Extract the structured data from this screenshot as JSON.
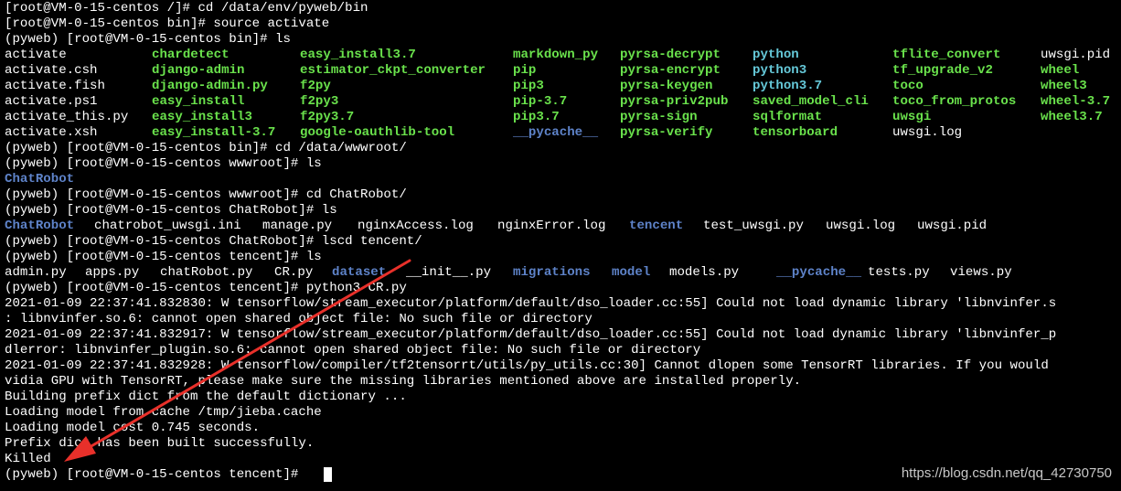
{
  "terminal": {
    "prompt_root_1": "[root@VM-0-15-centos /]# cd /data/env/pyweb/bin",
    "prompt_root_2": "[root@VM-0-15-centos bin]# source activate",
    "prompt_ls_bin": "(pyweb) [root@VM-0-15-centos bin]# ls",
    "bin_listing": [
      [
        {
          "text": "activate",
          "color": "white"
        },
        {
          "text": "chardetect",
          "color": "green"
        },
        {
          "text": "easy_install3.7",
          "color": "green"
        },
        {
          "text": "markdown_py",
          "color": "green"
        },
        {
          "text": "pyrsa-decrypt",
          "color": "green"
        },
        {
          "text": "python",
          "color": "cyan"
        },
        {
          "text": "tflite_convert",
          "color": "green"
        },
        {
          "text": "uwsgi.pid",
          "color": "white"
        }
      ],
      [
        {
          "text": "activate.csh",
          "color": "white"
        },
        {
          "text": "django-admin",
          "color": "green"
        },
        {
          "text": "estimator_ckpt_converter",
          "color": "green"
        },
        {
          "text": "pip",
          "color": "green"
        },
        {
          "text": "pyrsa-encrypt",
          "color": "green"
        },
        {
          "text": "python3",
          "color": "cyan"
        },
        {
          "text": "tf_upgrade_v2",
          "color": "green"
        },
        {
          "text": "wheel",
          "color": "green"
        }
      ],
      [
        {
          "text": "activate.fish",
          "color": "white"
        },
        {
          "text": "django-admin.py",
          "color": "green"
        },
        {
          "text": "f2py",
          "color": "green"
        },
        {
          "text": "pip3",
          "color": "green"
        },
        {
          "text": "pyrsa-keygen",
          "color": "green"
        },
        {
          "text": "python3.7",
          "color": "cyan"
        },
        {
          "text": "toco",
          "color": "green"
        },
        {
          "text": "wheel3",
          "color": "green"
        }
      ],
      [
        {
          "text": "activate.ps1",
          "color": "white"
        },
        {
          "text": "easy_install",
          "color": "green"
        },
        {
          "text": "f2py3",
          "color": "green"
        },
        {
          "text": "pip-3.7",
          "color": "green"
        },
        {
          "text": "pyrsa-priv2pub",
          "color": "green"
        },
        {
          "text": "saved_model_cli",
          "color": "green"
        },
        {
          "text": "toco_from_protos",
          "color": "green"
        },
        {
          "text": "wheel-3.7",
          "color": "green"
        }
      ],
      [
        {
          "text": "activate_this.py",
          "color": "white"
        },
        {
          "text": "easy_install3",
          "color": "green"
        },
        {
          "text": "f2py3.7",
          "color": "green"
        },
        {
          "text": "pip3.7",
          "color": "green"
        },
        {
          "text": "pyrsa-sign",
          "color": "green"
        },
        {
          "text": "sqlformat",
          "color": "green"
        },
        {
          "text": "uwsgi",
          "color": "green"
        },
        {
          "text": "wheel3.7",
          "color": "green"
        }
      ],
      [
        {
          "text": "activate.xsh",
          "color": "white"
        },
        {
          "text": "easy_install-3.7",
          "color": "green"
        },
        {
          "text": "google-oauthlib-tool",
          "color": "green"
        },
        {
          "text": "__pycache__",
          "color": "blue"
        },
        {
          "text": "pyrsa-verify",
          "color": "green"
        },
        {
          "text": "tensorboard",
          "color": "green"
        },
        {
          "text": "uwsgi.log",
          "color": "white"
        },
        {
          "text": "",
          "color": "white"
        }
      ]
    ],
    "prompt_cd_wwwroot": "(pyweb) [root@VM-0-15-centos bin]# cd /data/wwwroot/",
    "prompt_ls_wwwroot": "(pyweb) [root@VM-0-15-centos wwwroot]# ls",
    "wwwroot_listing": "ChatRobot",
    "prompt_cd_chatrobot": "(pyweb) [root@VM-0-15-centos wwwroot]# cd ChatRobot/",
    "prompt_ls_chatrobot": "(pyweb) [root@VM-0-15-centos ChatRobot]# ls",
    "chatrobot_listing": [
      {
        "text": "ChatRobot",
        "color": "blue"
      },
      {
        "text": "chatrobot_uwsgi.ini",
        "color": "white"
      },
      {
        "text": "manage.py",
        "color": "white"
      },
      {
        "text": "nginxAccess.log",
        "color": "white"
      },
      {
        "text": "nginxError.log",
        "color": "white"
      },
      {
        "text": "tencent",
        "color": "blue"
      },
      {
        "text": "test_uwsgi.py",
        "color": "white"
      },
      {
        "text": "uwsgi.log",
        "color": "white"
      },
      {
        "text": "uwsgi.pid",
        "color": "white"
      }
    ],
    "prompt_ls_chatrobot_2": "(pyweb) [root@VM-0-15-centos ChatRobot]# ls",
    "cd_tencent_cmd": "cd tencent/",
    "prompt_ls_tencent": "(pyweb) [root@VM-0-15-centos tencent]# ls",
    "tencent_listing": [
      {
        "text": "admin.py",
        "color": "white"
      },
      {
        "text": "apps.py",
        "color": "white"
      },
      {
        "text": "chatRobot.py",
        "color": "white"
      },
      {
        "text": "CR.py",
        "color": "white"
      },
      {
        "text": "dataset",
        "color": "blue"
      },
      {
        "text": "__init__.py",
        "color": "white"
      },
      {
        "text": "migrations",
        "color": "blue"
      },
      {
        "text": "model",
        "color": "blue"
      },
      {
        "text": "models.py",
        "color": "white"
      },
      {
        "text": "__pycache__",
        "color": "blue"
      },
      {
        "text": "tests.py",
        "color": "white"
      },
      {
        "text": "views.py",
        "color": "white"
      }
    ],
    "prompt_run": "(pyweb) [root@VM-0-15-centos tencent]# python3 CR.py",
    "log_lines": [
      "2021-01-09 22:37:41.832830: W tensorflow/stream_executor/platform/default/dso_loader.cc:55] Could not load dynamic library 'libnvinfer.s",
      ": libnvinfer.so.6: cannot open shared object file: No such file or directory",
      "2021-01-09 22:37:41.832917: W tensorflow/stream_executor/platform/default/dso_loader.cc:55] Could not load dynamic library 'libnvinfer_p",
      "dlerror: libnvinfer_plugin.so.6: cannot open shared object file: No such file or directory",
      "2021-01-09 22:37:41.832928: W tensorflow/compiler/tf2tensorrt/utils/py_utils.cc:30] Cannot dlopen some TensorRT libraries. If you would",
      "vidia GPU with TensorRT, please make sure the missing libraries mentioned above are installed properly.",
      "Building prefix dict from the default dictionary ...",
      "Loading model from cache /tmp/jieba.cache",
      "Loading model cost 0.745 seconds.",
      "Prefix dict has been built successfully.",
      "Killed"
    ],
    "final_prompt": "(pyweb) [root@VM-0-15-centos tencent]# "
  },
  "watermark": "https://blog.csdn.net/qq_42730750",
  "colors": {
    "background": "#000000",
    "text": "#ffffff",
    "executable": "#6ae24c",
    "directory": "#5e83c9",
    "symlink": "#65c8d8",
    "annotation_arrow": "#e8302a"
  }
}
